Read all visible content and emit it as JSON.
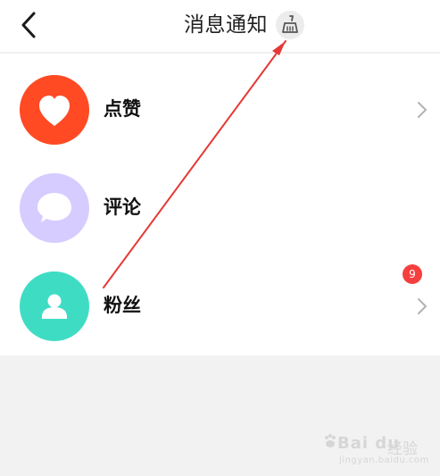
{
  "header": {
    "title": "消息通知",
    "back_icon": "chevron-left-icon",
    "clear_icon": "broom-icon"
  },
  "notifications": [
    {
      "label": "点赞",
      "icon": "heart-icon",
      "color": "#ff4a24",
      "trailing": "chevron-right-icon"
    },
    {
      "label": "评论",
      "icon": "speech-bubble-icon",
      "color": "#d6ccff",
      "trailing_badge": "9"
    },
    {
      "label": "粉丝",
      "icon": "person-icon",
      "color": "#3fdcc4",
      "trailing": "chevron-right-icon"
    }
  ],
  "colors": {
    "badge": "#f53f3f",
    "annotation_arrow": "#e53935"
  },
  "watermark": {
    "brand": "Bai du",
    "suffix": "经验",
    "url": "jingyan.baidu.com"
  }
}
